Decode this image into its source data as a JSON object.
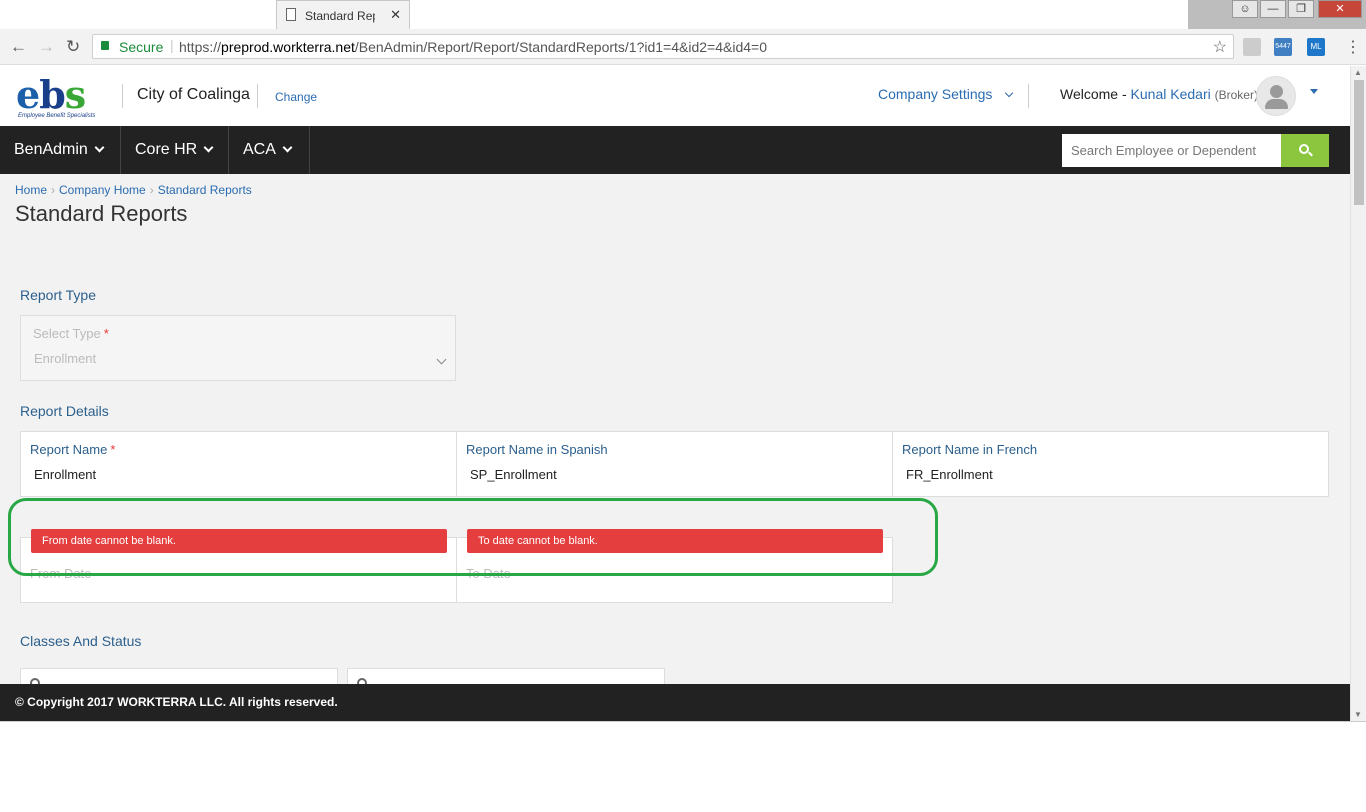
{
  "browser": {
    "tab_title": "Standard Rep",
    "tab_close": "✕",
    "secure_label": "Secure",
    "url_scheme": "https://",
    "url_host": "preprod.workterra.net",
    "url_path": "/BenAdmin/Report/Report/StandardReports/1?id1=4&id2=4&id4=0",
    "ext_badge": "5447",
    "ext_ml": "ML"
  },
  "header": {
    "logo_text": "ebs",
    "logo_tagline": "Employee Benefit Specialists",
    "company_name": "City of Coalinga",
    "change_link": "Change",
    "company_settings": "Company Settings",
    "welcome_prefix": "Welcome -",
    "user_name": "Kunal Kedari",
    "user_role": "(Broker)"
  },
  "nav": {
    "items": [
      {
        "label": "BenAdmin"
      },
      {
        "label": "Core HR"
      },
      {
        "label": "ACA"
      }
    ],
    "search_placeholder": "Search Employee or Dependent"
  },
  "breadcrumb": [
    "Home",
    "Company Home",
    "Standard Reports"
  ],
  "page_title": "Standard Reports",
  "report_type": {
    "section_label": "Report Type",
    "select_label": "Select Type",
    "select_value": "Enrollment"
  },
  "report_details": {
    "section_label": "Report Details",
    "fields": [
      {
        "label": "Report Name",
        "value": "Enrollment",
        "required": true
      },
      {
        "label": "Report Name in Spanish",
        "value": "SP_Enrollment"
      },
      {
        "label": "Report Name in French",
        "value": "FR_Enrollment"
      }
    ]
  },
  "dates": {
    "from_label": "From Date",
    "to_label": "To Date",
    "from_error": "From date cannot be blank.",
    "to_error": "To date cannot be blank."
  },
  "classes_and_status": {
    "section_label": "Classes And Status"
  },
  "footer": {
    "copyright": "© Copyright 2017 WORKTERRA LLC. All rights reserved."
  },
  "colors": {
    "link_blue": "#2b6cb0",
    "nav_dark": "#222222",
    "search_green": "#8cc63f",
    "error_red": "#e53e3e",
    "highlight_green": "#28a745"
  }
}
